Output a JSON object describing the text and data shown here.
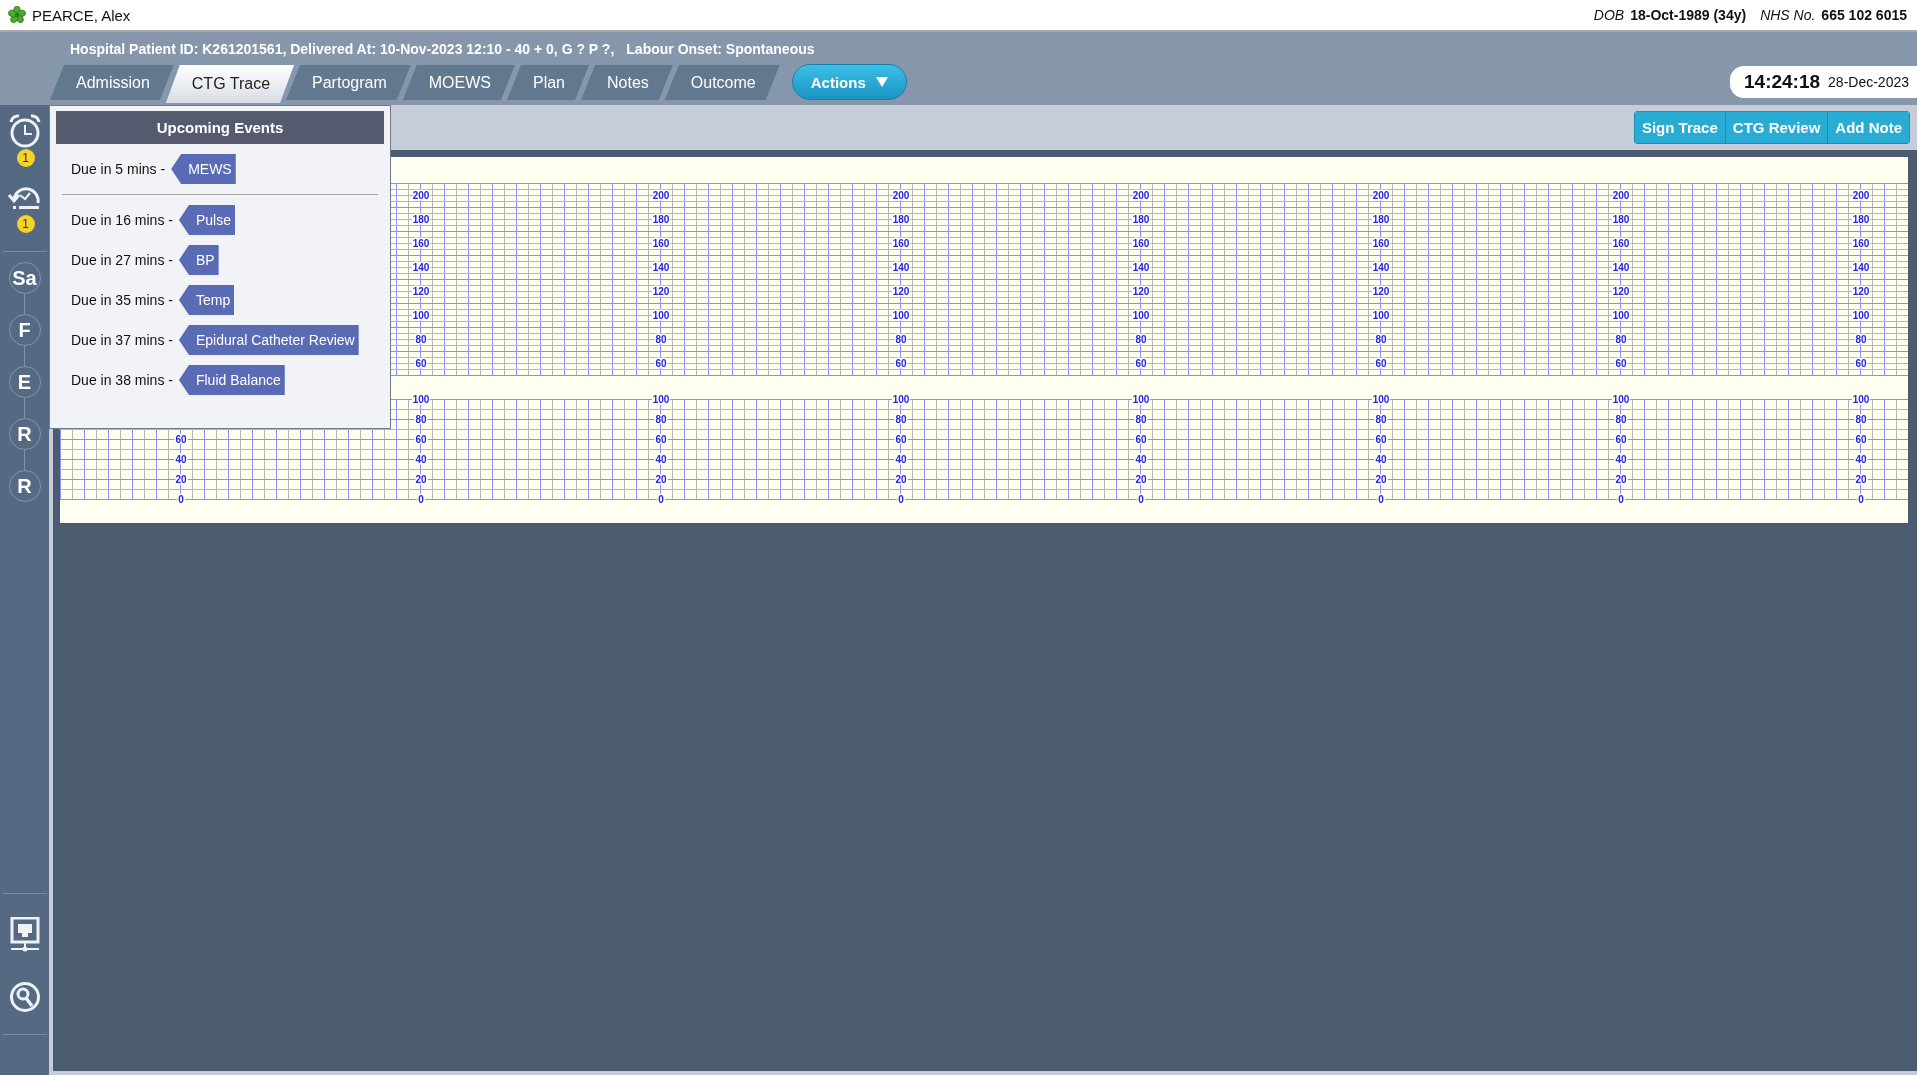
{
  "patient": {
    "name": "PEARCE, Alex",
    "dob_label": "DOB",
    "dob": "18-Oct-1989 (34y)",
    "nhs_label": "NHS No.",
    "nhs_number": "665 102 6015"
  },
  "info_line": {
    "details": "Hospital Patient ID: K261201561, Delivered At: 10-Nov-2023 12:10 - 40 + 0, G ? P ?,",
    "labour_onset": "Labour Onset: Spontaneous"
  },
  "tabs": [
    {
      "label": "Admission",
      "selected": false
    },
    {
      "label": "CTG Trace",
      "selected": true
    },
    {
      "label": "Partogram",
      "selected": false
    },
    {
      "label": "MOEWS",
      "selected": false
    },
    {
      "label": "Plan",
      "selected": false
    },
    {
      "label": "Notes",
      "selected": false
    },
    {
      "label": "Outcome",
      "selected": false
    }
  ],
  "actions_button": {
    "label": "Actions"
  },
  "clock": {
    "time": "14:24:18",
    "date": "28-Dec-2023"
  },
  "toolbar_buttons": [
    "Sign Trace",
    "CTG Review",
    "Add Note"
  ],
  "sidebar": {
    "alerts": [
      {
        "kind": "alarm",
        "badge": "1"
      },
      {
        "kind": "snooze",
        "badge": "1"
      }
    ],
    "nodes": [
      "Sa",
      "F",
      "E",
      "R",
      "R"
    ],
    "tools": [
      {
        "kind": "network"
      },
      {
        "kind": "search"
      }
    ]
  },
  "upcoming_events": {
    "title": "Upcoming Events",
    "groups": [
      [
        {
          "due": "Due in 5 mins -",
          "event": "MEWS"
        }
      ],
      [
        {
          "due": "Due in 16 mins -",
          "event": "Pulse"
        },
        {
          "due": "Due in 27 mins -",
          "event": "BP"
        },
        {
          "due": "Due in 35 mins -",
          "event": "Temp"
        },
        {
          "due": "Due in 37 mins -",
          "event": "Epidural Catheter Review"
        },
        {
          "due": "Due in 38 mins -",
          "event": "Fluid Balance"
        }
      ]
    ]
  },
  "trace": {
    "fhr_scale_columns": [
      [],
      [
        "200",
        "180",
        "160",
        "140",
        "120",
        "100",
        "80",
        "60"
      ],
      [
        "200",
        "180",
        "160",
        "140",
        "120",
        "100",
        "80",
        "60"
      ],
      [
        "200",
        "180",
        "160",
        "140",
        "120",
        "100",
        "80",
        "60"
      ],
      [
        "200",
        "180",
        "160",
        "140",
        "120",
        "100",
        "80",
        "60"
      ],
      [
        "200",
        "180",
        "160",
        "140",
        "120",
        "100",
        "80",
        "60"
      ],
      [
        "200",
        "180",
        "160",
        "140",
        "120",
        "100",
        "80",
        "60"
      ],
      [
        "200",
        "180",
        "160",
        "140",
        "120",
        "100",
        "80",
        "60"
      ]
    ],
    "toco_scale_columns": [
      [
        "60",
        "40",
        "20",
        "0"
      ],
      [
        "100",
        "80",
        "60",
        "40",
        "20",
        "0"
      ],
      [
        "100",
        "80",
        "60",
        "40",
        "20",
        "0"
      ],
      [
        "100",
        "80",
        "60",
        "40",
        "20",
        "0"
      ],
      [
        "100",
        "80",
        "60",
        "40",
        "20",
        "0"
      ],
      [
        "100",
        "80",
        "60",
        "40",
        "20",
        "0"
      ],
      [
        "100",
        "80",
        "60",
        "40",
        "20",
        "0"
      ],
      [
        "100",
        "80",
        "60",
        "40",
        "20",
        "0"
      ]
    ]
  }
}
